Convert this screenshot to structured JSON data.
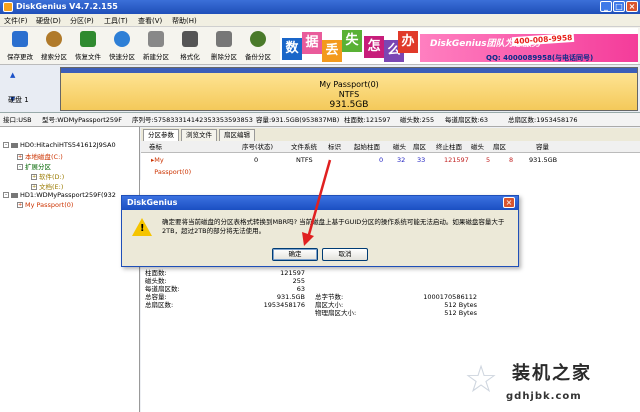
{
  "window": {
    "title": "DiskGenius V4.7.2.155"
  },
  "menu": [
    "文件(F)",
    "硬盘(D)",
    "分区(P)",
    "工具(T)",
    "查看(V)",
    "帮助(H)"
  ],
  "toolbar": [
    {
      "label": "保存更改",
      "icon": "save-icon",
      "color": "#2b6fcf"
    },
    {
      "label": "搜索分区",
      "icon": "search-icon",
      "color": "#b07a2a"
    },
    {
      "label": "恢复文件",
      "icon": "recover-file-icon",
      "color": "#2f8a2f"
    },
    {
      "label": "快速分区",
      "icon": "quick-partition-icon",
      "color": "#2e7fd6"
    },
    {
      "label": "新建分区",
      "icon": "new-partition-icon",
      "color": "#888888"
    },
    {
      "label": "格式化",
      "icon": "format-icon",
      "color": "#555555"
    },
    {
      "label": "删除分区",
      "icon": "delete-icon",
      "color": "#777777"
    },
    {
      "label": "备份分区",
      "icon": "backup-icon",
      "color": "#4a7a2a"
    }
  ],
  "banner": {
    "chars": [
      "数",
      "据",
      "丢",
      "失",
      "怎",
      "么",
      "办"
    ],
    "brand": "DiskGenius团队为您服务",
    "phone": "400-008-9958",
    "qq": "QQ: 4000089958(与电话同号)"
  },
  "disk_visual": {
    "label": "硬盘 1",
    "name": "My Passport(0)",
    "fs": "NTFS",
    "size": "931.5GB"
  },
  "infobar": {
    "interface": "接口:USB",
    "model": "型号:WDMyPassport259F",
    "serial": "序列号:575833314142353353593853",
    "capacity": "容量:931.5GB(953837MB)",
    "cylinders": "柱面数:121597",
    "heads": "磁头数:255",
    "sectors_per_track": "每道扇区数:63",
    "total_sectors": "总扇区数:1953458176"
  },
  "tree": [
    {
      "text": "HD0:HitachiHTS541612J9SA0",
      "color": "#000000",
      "indent": 0
    },
    {
      "text": "本地磁盘(C:)",
      "color": "#cc3300",
      "indent": 1
    },
    {
      "text": "扩展分区",
      "color": "#006600",
      "indent": 1
    },
    {
      "text": "软件(D:)",
      "color": "#9a7a00",
      "indent": 2
    },
    {
      "text": "文档(E:)",
      "color": "#9a7a00",
      "indent": 2
    },
    {
      "text": "HD1:WDMyPassport259F(932",
      "color": "#000000",
      "indent": 0
    },
    {
      "text": "My Passport(0)",
      "color": "#cc3300",
      "indent": 1
    }
  ],
  "tabs": [
    "分区参数",
    "浏览文件",
    "扇区编辑"
  ],
  "table": {
    "headers": [
      "卷标",
      "序号(状态)",
      "文件系统",
      "标识",
      "起始柱面",
      "磁头",
      "扇区",
      "终止柱面",
      "磁头",
      "扇区",
      "容量"
    ],
    "row": [
      "My Passport(0)",
      "0",
      "NTFS",
      "",
      "0",
      "32",
      "33",
      "121597",
      "5",
      "8",
      "931.5GB"
    ]
  },
  "props_left": {
    "labels": [
      "柱面数:",
      "磁头数:",
      "每道扇区数:",
      "总容量:",
      "总扇区数:"
    ],
    "values": [
      "121597",
      "255",
      "63",
      "931.5GB",
      "1953458176"
    ]
  },
  "props_right": {
    "labels": [
      "总字节数:",
      "扇区大小:",
      "物理扇区大小:"
    ],
    "values": [
      "1000170586112",
      "512 Bytes",
      "512 Bytes"
    ]
  },
  "dialog": {
    "title": "DiskGenius",
    "message": "确定要将当前磁盘的分区表格式转换到MBR吗? 当前磁盘上基于GUID分区的操作系统可能无法启动。如果磁盘容量大于2TB，超过2TB的部分将无法使用。",
    "ok": "确定",
    "cancel": "取消"
  },
  "watermark": {
    "title": "装机之家",
    "url": "gdhjbk.com"
  }
}
